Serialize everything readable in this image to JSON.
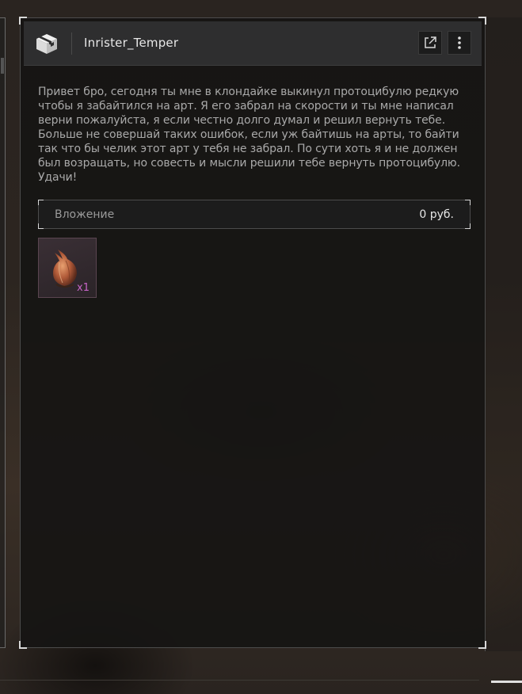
{
  "window": {
    "sender_name": "Inrister_Temper",
    "message_text": "Привет бро, сегодня ты мне в клондайке выкинул протоцибулю редкую чтобы я забайтился на арт. Я его забрал на скорости и ты мне написал верни пожалуйста, я если честно долго думал и решил вернуть тебе. Больше не совершай таких ошибок, если уж байтишь на арты, то байти так что бы челик этот арт у тебя не забрал. По сути хоть я и не должен был возращать, но совесть и мысли решили тебе вернуть протоцибулю. Удачи!"
  },
  "attachment": {
    "label": "Вложение",
    "amount": "0 руб."
  },
  "items": [
    {
      "icon": "onion-artifact-icon",
      "quantity": "x1"
    }
  ],
  "icons": {
    "header_left": "package-box-icon",
    "open": "external-link-icon",
    "more": "more-vertical-icon"
  },
  "colors": {
    "quantity": "#c865c8",
    "text": "#a9a9a9",
    "title": "#e8e8e8"
  }
}
